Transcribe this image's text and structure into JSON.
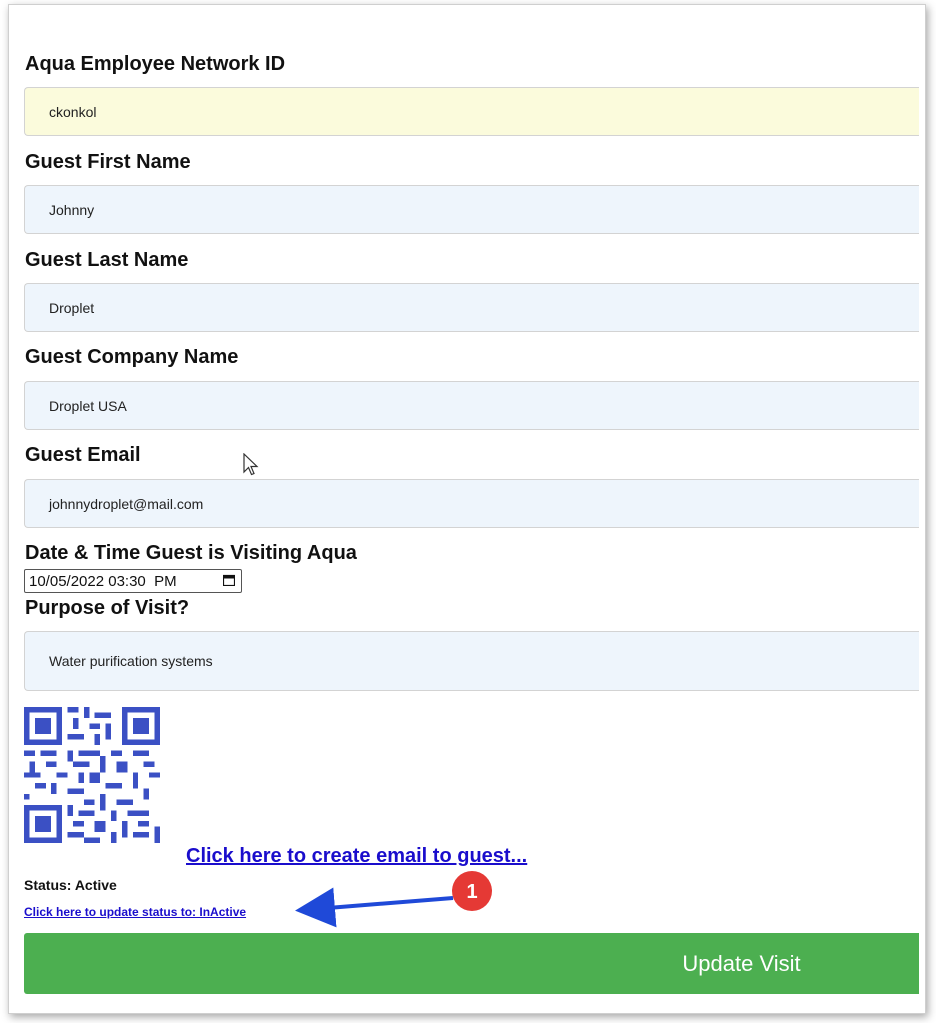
{
  "form": {
    "network_id": {
      "label": "Aqua Employee Network ID",
      "value": "ckonkol"
    },
    "first_name": {
      "label": "Guest First Name",
      "value": "Johnny"
    },
    "last_name": {
      "label": "Guest Last Name",
      "value": "Droplet"
    },
    "company": {
      "label": "Guest Company Name",
      "value": "Droplet USA"
    },
    "email": {
      "label": "Guest Email",
      "value": "johnnydroplet@mail.com"
    },
    "visit_datetime": {
      "label": "Date & Time Guest is Visiting Aqua",
      "value": "10/05/2022 03:30  PM"
    },
    "purpose": {
      "label": "Purpose of Visit?",
      "value": "Water purification systems"
    }
  },
  "links": {
    "create_email": "Click here to create email to guest...",
    "update_status": "Click here to update status to: InActive"
  },
  "status": {
    "text": "Status: Active"
  },
  "actions": {
    "update_label": "Update Visit"
  },
  "annotation": {
    "number": "1"
  },
  "colors": {
    "accent_green": "#4caf50",
    "link_blue": "#1a0dcc",
    "field_blue": "#eef5fc",
    "field_yellow": "#fbfbdc",
    "annotation_red": "#e53935",
    "arrow_blue": "#1f49d8",
    "qr_blue": "#3b50c4"
  },
  "icons": {
    "calendar": "calendar-icon",
    "cursor": "mouse-cursor-icon",
    "qr": "qr-code-icon"
  }
}
